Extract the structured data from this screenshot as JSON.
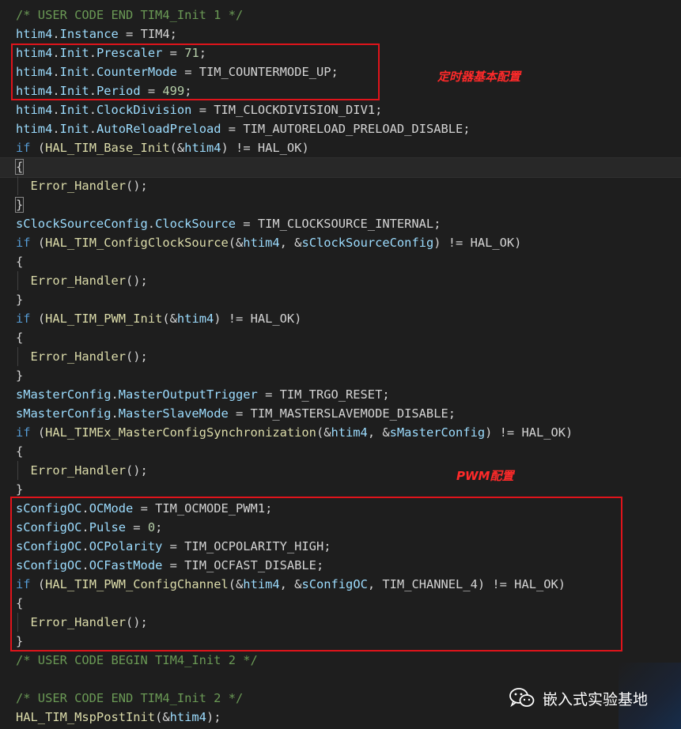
{
  "code_lines": [
    [
      {
        "t": "/* USER CODE END TIM4_Init 1 */",
        "c": "cm"
      }
    ],
    [
      {
        "t": "htim4",
        "c": "vr"
      },
      {
        "t": ".",
        "c": "ma"
      },
      {
        "t": "Instance",
        "c": "vr"
      },
      {
        "t": " = TIM4;",
        "c": "ma"
      }
    ],
    [
      {
        "t": "htim4",
        "c": "vr"
      },
      {
        "t": ".",
        "c": "ma"
      },
      {
        "t": "Init",
        "c": "vr"
      },
      {
        "t": ".",
        "c": "ma"
      },
      {
        "t": "Prescaler",
        "c": "vr"
      },
      {
        "t": " = ",
        "c": "ma"
      },
      {
        "t": "71",
        "c": "nm"
      },
      {
        "t": ";",
        "c": "ma"
      }
    ],
    [
      {
        "t": "htim4",
        "c": "vr"
      },
      {
        "t": ".",
        "c": "ma"
      },
      {
        "t": "Init",
        "c": "vr"
      },
      {
        "t": ".",
        "c": "ma"
      },
      {
        "t": "CounterMode",
        "c": "vr"
      },
      {
        "t": " = TIM_COUNTERMODE_UP;",
        "c": "ma"
      }
    ],
    [
      {
        "t": "htim4",
        "c": "vr"
      },
      {
        "t": ".",
        "c": "ma"
      },
      {
        "t": "Init",
        "c": "vr"
      },
      {
        "t": ".",
        "c": "ma"
      },
      {
        "t": "Period",
        "c": "vr"
      },
      {
        "t": " = ",
        "c": "ma"
      },
      {
        "t": "499",
        "c": "nm"
      },
      {
        "t": ";",
        "c": "ma"
      }
    ],
    [
      {
        "t": "htim4",
        "c": "vr"
      },
      {
        "t": ".",
        "c": "ma"
      },
      {
        "t": "Init",
        "c": "vr"
      },
      {
        "t": ".",
        "c": "ma"
      },
      {
        "t": "ClockDivision",
        "c": "vr"
      },
      {
        "t": " = TIM_CLOCKDIVISION_DIV1;",
        "c": "ma"
      }
    ],
    [
      {
        "t": "htim4",
        "c": "vr"
      },
      {
        "t": ".",
        "c": "ma"
      },
      {
        "t": "Init",
        "c": "vr"
      },
      {
        "t": ".",
        "c": "ma"
      },
      {
        "t": "AutoReloadPreload",
        "c": "vr"
      },
      {
        "t": " = TIM_AUTORELOAD_PRELOAD_DISABLE;",
        "c": "ma"
      }
    ],
    [
      {
        "t": "if",
        "c": "kw"
      },
      {
        "t": " (",
        "c": "ma"
      },
      {
        "t": "HAL_TIM_Base_Init",
        "c": "fn"
      },
      {
        "t": "(&",
        "c": "ma"
      },
      {
        "t": "htim4",
        "c": "vr"
      },
      {
        "t": ") != HAL_OK)",
        "c": "ma"
      }
    ],
    [
      {
        "t": "{",
        "c": "ma",
        "hl": true
      }
    ],
    [
      {
        "t": "  ",
        "c": "ma"
      },
      {
        "t": "Error_Handler",
        "c": "fn"
      },
      {
        "t": "();",
        "c": "ma"
      }
    ],
    [
      {
        "t": "}",
        "c": "ma",
        "hl": true
      }
    ],
    [
      {
        "t": "sClockSourceConfig",
        "c": "vr"
      },
      {
        "t": ".",
        "c": "ma"
      },
      {
        "t": "ClockSource",
        "c": "vr"
      },
      {
        "t": " = TIM_CLOCKSOURCE_INTERNAL;",
        "c": "ma"
      }
    ],
    [
      {
        "t": "if",
        "c": "kw"
      },
      {
        "t": " (",
        "c": "ma"
      },
      {
        "t": "HAL_TIM_ConfigClockSource",
        "c": "fn"
      },
      {
        "t": "(&",
        "c": "ma"
      },
      {
        "t": "htim4",
        "c": "vr"
      },
      {
        "t": ", &",
        "c": "ma"
      },
      {
        "t": "sClockSourceConfig",
        "c": "vr"
      },
      {
        "t": ") != HAL_OK)",
        "c": "ma"
      }
    ],
    [
      {
        "t": "{",
        "c": "ma"
      }
    ],
    [
      {
        "t": "  ",
        "c": "ma"
      },
      {
        "t": "Error_Handler",
        "c": "fn"
      },
      {
        "t": "();",
        "c": "ma"
      }
    ],
    [
      {
        "t": "}",
        "c": "ma"
      }
    ],
    [
      {
        "t": "if",
        "c": "kw"
      },
      {
        "t": " (",
        "c": "ma"
      },
      {
        "t": "HAL_TIM_PWM_Init",
        "c": "fn"
      },
      {
        "t": "(&",
        "c": "ma"
      },
      {
        "t": "htim4",
        "c": "vr"
      },
      {
        "t": ") != HAL_OK)",
        "c": "ma"
      }
    ],
    [
      {
        "t": "{",
        "c": "ma"
      }
    ],
    [
      {
        "t": "  ",
        "c": "ma"
      },
      {
        "t": "Error_Handler",
        "c": "fn"
      },
      {
        "t": "();",
        "c": "ma"
      }
    ],
    [
      {
        "t": "}",
        "c": "ma"
      }
    ],
    [
      {
        "t": "sMasterConfig",
        "c": "vr"
      },
      {
        "t": ".",
        "c": "ma"
      },
      {
        "t": "MasterOutputTrigger",
        "c": "vr"
      },
      {
        "t": " = TIM_TRGO_RESET;",
        "c": "ma"
      }
    ],
    [
      {
        "t": "sMasterConfig",
        "c": "vr"
      },
      {
        "t": ".",
        "c": "ma"
      },
      {
        "t": "MasterSlaveMode",
        "c": "vr"
      },
      {
        "t": " = TIM_MASTERSLAVEMODE_DISABLE;",
        "c": "ma"
      }
    ],
    [
      {
        "t": "if",
        "c": "kw"
      },
      {
        "t": " (",
        "c": "ma"
      },
      {
        "t": "HAL_TIMEx_MasterConfigSynchronization",
        "c": "fn"
      },
      {
        "t": "(&",
        "c": "ma"
      },
      {
        "t": "htim4",
        "c": "vr"
      },
      {
        "t": ", &",
        "c": "ma"
      },
      {
        "t": "sMasterConfig",
        "c": "vr"
      },
      {
        "t": ") != HAL_OK)",
        "c": "ma"
      }
    ],
    [
      {
        "t": "{",
        "c": "ma"
      }
    ],
    [
      {
        "t": "  ",
        "c": "ma"
      },
      {
        "t": "Error_Handler",
        "c": "fn"
      },
      {
        "t": "();",
        "c": "ma"
      }
    ],
    [
      {
        "t": "}",
        "c": "ma"
      }
    ],
    [
      {
        "t": "sConfigOC",
        "c": "vr"
      },
      {
        "t": ".",
        "c": "ma"
      },
      {
        "t": "OCMode",
        "c": "vr"
      },
      {
        "t": " = TIM_OCMODE_PWM1;",
        "c": "ma"
      }
    ],
    [
      {
        "t": "sConfigOC",
        "c": "vr"
      },
      {
        "t": ".",
        "c": "ma"
      },
      {
        "t": "Pulse",
        "c": "vr"
      },
      {
        "t": " = ",
        "c": "ma"
      },
      {
        "t": "0",
        "c": "nm"
      },
      {
        "t": ";",
        "c": "ma"
      }
    ],
    [
      {
        "t": "sConfigOC",
        "c": "vr"
      },
      {
        "t": ".",
        "c": "ma"
      },
      {
        "t": "OCPolarity",
        "c": "vr"
      },
      {
        "t": " = TIM_OCPOLARITY_HIGH;",
        "c": "ma"
      }
    ],
    [
      {
        "t": "sConfigOC",
        "c": "vr"
      },
      {
        "t": ".",
        "c": "ma"
      },
      {
        "t": "OCFastMode",
        "c": "vr"
      },
      {
        "t": " = TIM_OCFAST_DISABLE;",
        "c": "ma"
      }
    ],
    [
      {
        "t": "if",
        "c": "kw"
      },
      {
        "t": " (",
        "c": "ma"
      },
      {
        "t": "HAL_TIM_PWM_ConfigChannel",
        "c": "fn"
      },
      {
        "t": "(&",
        "c": "ma"
      },
      {
        "t": "htim4",
        "c": "vr"
      },
      {
        "t": ", &",
        "c": "ma"
      },
      {
        "t": "sConfigOC",
        "c": "vr"
      },
      {
        "t": ", TIM_CHANNEL_4) != HAL_OK)",
        "c": "ma"
      }
    ],
    [
      {
        "t": "{",
        "c": "ma"
      }
    ],
    [
      {
        "t": "  ",
        "c": "ma"
      },
      {
        "t": "Error_Handler",
        "c": "fn"
      },
      {
        "t": "();",
        "c": "ma"
      }
    ],
    [
      {
        "t": "}",
        "c": "ma"
      }
    ],
    [
      {
        "t": "/* USER CODE BEGIN TIM4_Init 2 */",
        "c": "cm"
      }
    ],
    [],
    [
      {
        "t": "/* USER CODE END TIM4_Init 2 */",
        "c": "cm"
      }
    ],
    [
      {
        "t": "HAL_TIM_MspPostInit",
        "c": "fn"
      },
      {
        "t": "(&",
        "c": "ma"
      },
      {
        "t": "htim4",
        "c": "vr"
      },
      {
        "t": ");",
        "c": "ma"
      }
    ]
  ],
  "annotations": {
    "timer_base_label": "定时器基本配置",
    "pwm_label": "PWM配置"
  },
  "watermark": {
    "icon": "wechat-icon",
    "text": "嵌入式实验基地"
  },
  "colors": {
    "background": "#1e1e1e",
    "comment": "#6a9955",
    "keyword": "#569cd6",
    "variable": "#9cdcfe",
    "function": "#dcdcaa",
    "number": "#b5cea8",
    "default": "#d4d4d4",
    "annotation": "#e0141b"
  }
}
